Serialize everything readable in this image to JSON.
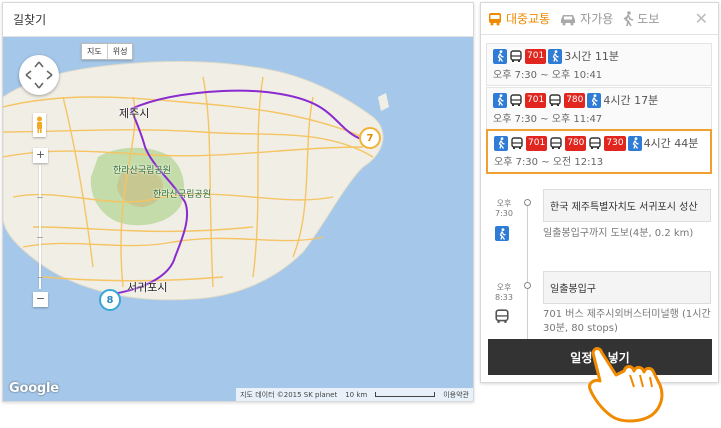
{
  "map": {
    "title": "길찾기",
    "map_type": {
      "map": "지도",
      "satellite": "위성"
    },
    "zoom_in": "+",
    "zoom_out": "−",
    "logo": "Google",
    "attribution": "지도 데이터 ©2015 SK planet",
    "scale": "10 km",
    "terms": "이용약관",
    "labels": {
      "jeju_city": "제주시",
      "seogwipo": "서귀포시",
      "park1": "한라산국립공원",
      "park2": "한라산국립공원"
    },
    "markers": {
      "start": "7",
      "end": "8"
    },
    "colors": {
      "route": "#8a2bd0",
      "sea": "#a5c8ea",
      "land": "#f1eee6",
      "road": "#f5c463"
    }
  },
  "panel": {
    "tabs": [
      {
        "label": "대중교통",
        "icon": "bus-icon",
        "active": true
      },
      {
        "label": "자가용",
        "icon": "car-icon",
        "active": false
      },
      {
        "label": "도보",
        "icon": "walk-icon",
        "active": false
      }
    ],
    "close": "✕",
    "routes": [
      {
        "buses": [
          "701"
        ],
        "duration": "3시간 11분",
        "time": "오후 7:30 ~ 오후 10:41"
      },
      {
        "buses": [
          "701",
          "780"
        ],
        "duration": "4시간 17분",
        "time": "오후 7:30 ~ 오후 11:47"
      },
      {
        "buses": [
          "701",
          "780",
          "730"
        ],
        "duration": "4시간 44분",
        "time": "오후 7:30 ~ 오전 12:13"
      }
    ],
    "steps": {
      "step1_time": "오후\n7:30",
      "step1_place": "한국 제주특별자치도 서귀포시 성산",
      "walk_desc": "일출봉입구까지 도보(4분, 0.2 km)",
      "step2_time": "오후\n8:33",
      "step2_place": "일출봉입구",
      "bus_desc": "701 버스 제주시외버스터미널행 (1시간 30분, 80 stops)"
    },
    "add_button": "일정에 넣기",
    "accent": "#f08a00"
  }
}
